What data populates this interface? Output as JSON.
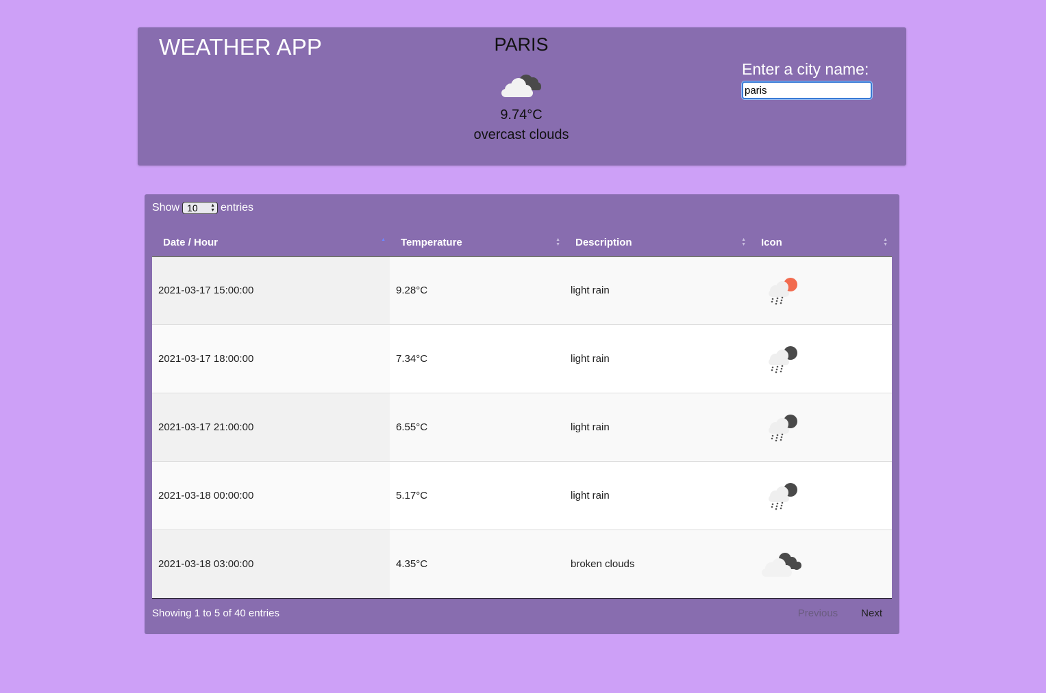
{
  "app": {
    "title": "WEATHER APP"
  },
  "current": {
    "city": "PARIS",
    "icon": "overcast-clouds-icon",
    "temperature": "9.74°C",
    "description": "overcast clouds"
  },
  "search": {
    "label": "Enter a city name:",
    "value": "paris"
  },
  "table": {
    "show_label": "Show",
    "length_value": "10",
    "entries_label": "entries",
    "columns": [
      "Date / Hour",
      "Temperature",
      "Description",
      "Icon"
    ],
    "rows": [
      {
        "date": "2021-03-17 15:00:00",
        "temp": "9.28°C",
        "desc": "light rain",
        "icon": "rain-sun-icon"
      },
      {
        "date": "2021-03-17 18:00:00",
        "temp": "7.34°C",
        "desc": "light rain",
        "icon": "rain-night-icon"
      },
      {
        "date": "2021-03-17 21:00:00",
        "temp": "6.55°C",
        "desc": "light rain",
        "icon": "rain-night-icon"
      },
      {
        "date": "2021-03-18 00:00:00",
        "temp": "5.17°C",
        "desc": "light rain",
        "icon": "rain-night-icon"
      },
      {
        "date": "2021-03-18 03:00:00",
        "temp": "4.35°C",
        "desc": "broken clouds",
        "icon": "broken-clouds-icon"
      }
    ],
    "info": "Showing 1 to 5 of 40 entries",
    "previous": "Previous",
    "next": "Next"
  },
  "colors": {
    "page_bg": "#cda0f7",
    "card_bg": "#886daf",
    "sun": "#f26b4f",
    "dark_cloud": "#4a4a4a"
  }
}
